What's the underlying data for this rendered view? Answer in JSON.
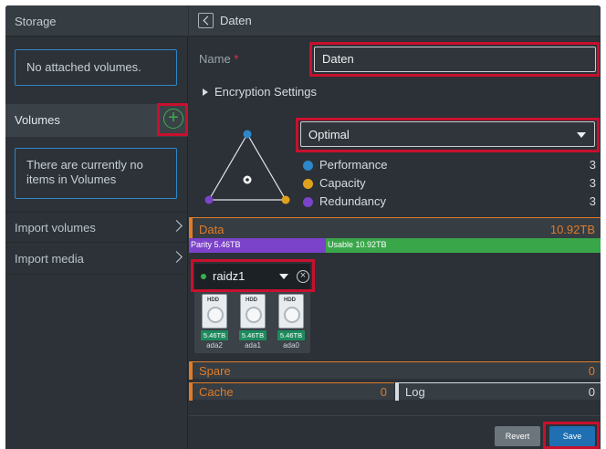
{
  "sidebar": {
    "title": "Storage",
    "attached_message": "No attached volumes.",
    "volumes_label": "Volumes",
    "add_icon": "plus-circle-icon",
    "empty_message": "There are currently no items in Volumes",
    "nav": [
      {
        "label": "Import volumes"
      },
      {
        "label": "Import media"
      }
    ]
  },
  "header": {
    "back_icon": "chevron-left-icon",
    "breadcrumb": "Daten"
  },
  "form": {
    "name_label": "Name",
    "required_mark": "*",
    "name_value": "Daten",
    "encryption_label": "Encryption Settings",
    "profile_selected": "Optimal",
    "metrics": [
      {
        "label": "Performance",
        "value": "3",
        "color": "#2f86c8"
      },
      {
        "label": "Capacity",
        "value": "3",
        "color": "#e0a21e"
      },
      {
        "label": "Redundancy",
        "value": "3",
        "color": "#7b43c9"
      }
    ]
  },
  "data_section": {
    "title": "Data",
    "total": "10.92TB",
    "parity_label": "Parity 5.46TB",
    "usable_label": "Usable 10.92TB",
    "parity_fraction": 0.333,
    "colors": {
      "parity": "#7b43c9",
      "usable": "#3aa64a",
      "accent": "#e07b28"
    },
    "vdev": {
      "status_color": "#37b24a",
      "type": "raidz1",
      "remove_icon": "circle-x-icon",
      "disks": [
        {
          "hdd": "HDD",
          "size": "5.46TB",
          "name": "ada2"
        },
        {
          "hdd": "HDD",
          "size": "5.46TB",
          "name": "ada1"
        },
        {
          "hdd": "HDD",
          "size": "5.46TB",
          "name": "ada0"
        }
      ]
    }
  },
  "spare": {
    "title": "Spare",
    "count": "0"
  },
  "cache": {
    "title": "Cache",
    "count": "0"
  },
  "log": {
    "title": "Log",
    "count": "0"
  },
  "actions": {
    "revert": "Revert",
    "save": "Save"
  }
}
